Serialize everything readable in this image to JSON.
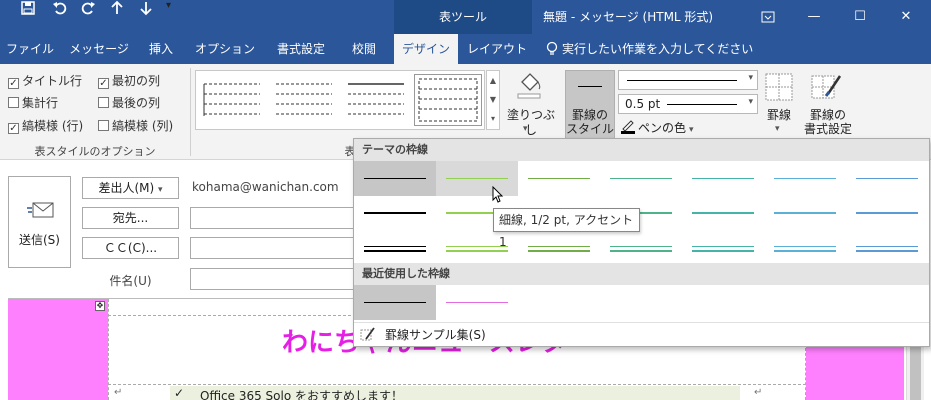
{
  "qat": {
    "save": "save",
    "undo": "undo",
    "redo": "redo",
    "up": "up",
    "down": "down",
    "customize": "customize"
  },
  "title": {
    "context_tab": "表ツール",
    "window": "無題 - メッセージ (HTML 形式)"
  },
  "tabs": [
    "ファイル",
    "メッセージ",
    "挿入",
    "オプション",
    "書式設定",
    "校閲",
    "デザイン",
    "レイアウト"
  ],
  "active_tab": "デザイン",
  "tell_me": "実行したい作業を入力してください",
  "ribbon": {
    "style_options": {
      "items": [
        {
          "label": "タイトル行",
          "checked": true
        },
        {
          "label": "最初の列",
          "checked": true
        },
        {
          "label": "集計行",
          "checked": false
        },
        {
          "label": "最後の列",
          "checked": false
        },
        {
          "label": "縞模様 (行)",
          "checked": true
        },
        {
          "label": "縞模様 (列)",
          "checked": false
        }
      ],
      "group_label": "表スタイルのオプション"
    },
    "table_styles_group_label": "表",
    "shading_label": "塗りつぶし",
    "border_style_label": [
      "罫線の",
      "スタイル"
    ],
    "pen_weight": "0.5 pt",
    "pen_color_label": "ペンの色",
    "borders_label": "罫線",
    "border_painter_label": [
      "罫線の",
      "書式設定"
    ]
  },
  "message": {
    "send_label": "送信(S)",
    "from_label": "差出人(M)",
    "from_value": "kohama@wanichan.com",
    "to_label": "宛先...",
    "cc_label": "ＣＣ(C)...",
    "subject_label": "件名(U)"
  },
  "body": {
    "heading": "わにちゃんニュースレター",
    "list_item": "Office 365 Solo をおすすめします！"
  },
  "dropdown": {
    "theme_header": "テーマの枠線",
    "recent_header": "最近使用した枠線",
    "sampler_label": "罫線サンプル集(S)",
    "theme_colors": [
      "#000000",
      "#92d050",
      "#70ad47",
      "#4db38a",
      "#44b3a8",
      "#5ab0d6",
      "#5b9bd5"
    ],
    "recent_colors": [
      "#000000",
      "#e36ce3"
    ]
  },
  "tooltip": "細線, 1/2 pt, アクセント 1"
}
